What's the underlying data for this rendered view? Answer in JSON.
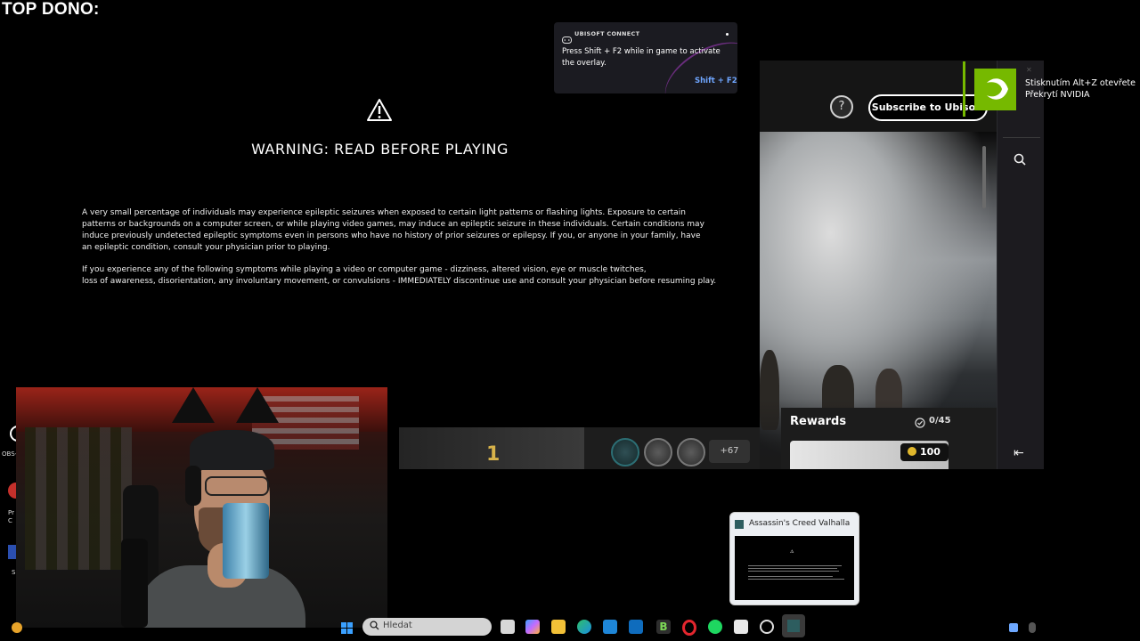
{
  "overlay": {
    "title": "TOP DONO:"
  },
  "warning": {
    "title": "WARNING: READ BEFORE PLAYING",
    "paragraph1": [
      "A very small percentage of individuals may experience epileptic seizures when exposed to certain light patterns or flashing lights. Exposure to certain",
      "patterns or backgrounds on a computer screen, or while playing video games, may induce an epileptic seizure in these individuals. Certain conditions may",
      "induce previously undetected epileptic symptoms even in persons who have no history of prior seizures or epilepsy. If you, or anyone in your family, have",
      "an epileptic condition, consult your physician prior to playing."
    ],
    "paragraph2": [
      "If you experience any of the following symptoms while playing a video or computer game - dizziness, altered vision, eye or muscle twitches,",
      "loss of awareness, disorientation, any involuntary movement, or convulsions - IMMEDIATELY discontinue use and consult your physician before resuming play."
    ]
  },
  "ubisoft_toast": {
    "brand": "UBISOFT CONNECT",
    "message": "Press Shift + F2 while in game to activate the overlay.",
    "shortcut": "Shift + F2"
  },
  "nvidia": {
    "message": "Stisknutím Alt+Z otevřete Překrytí NVIDIA"
  },
  "launcher": {
    "help_icon": "?",
    "subscribe_label": "Subscribe to Ubisoft",
    "rewards_title": "Rewards",
    "rewards_count": "0/45",
    "reward_points": "100",
    "rank": "1",
    "more_achievements": "+67",
    "collapse_icon": "⇤"
  },
  "desktop": {
    "obs_label": "OBS-",
    "pr_label": "Pr\nC",
    "s_label": "S"
  },
  "taskbar": {
    "search_placeholder": "Hledat",
    "preview_title": "Assassin's Creed Valhalla",
    "apps": [
      "explorer-icon",
      "copilot-icon",
      "folder-icon",
      "edge-icon",
      "store-icon",
      "outlook-icon",
      "b-app-icon",
      "opera-icon",
      "spotify-icon",
      "game-app-icon",
      "obs-icon",
      "valhalla-icon"
    ]
  },
  "colors": {
    "nvidia_green": "#76b900",
    "ubisoft_link": "#6fa6ff",
    "rank_gold": "#d7b24a"
  }
}
